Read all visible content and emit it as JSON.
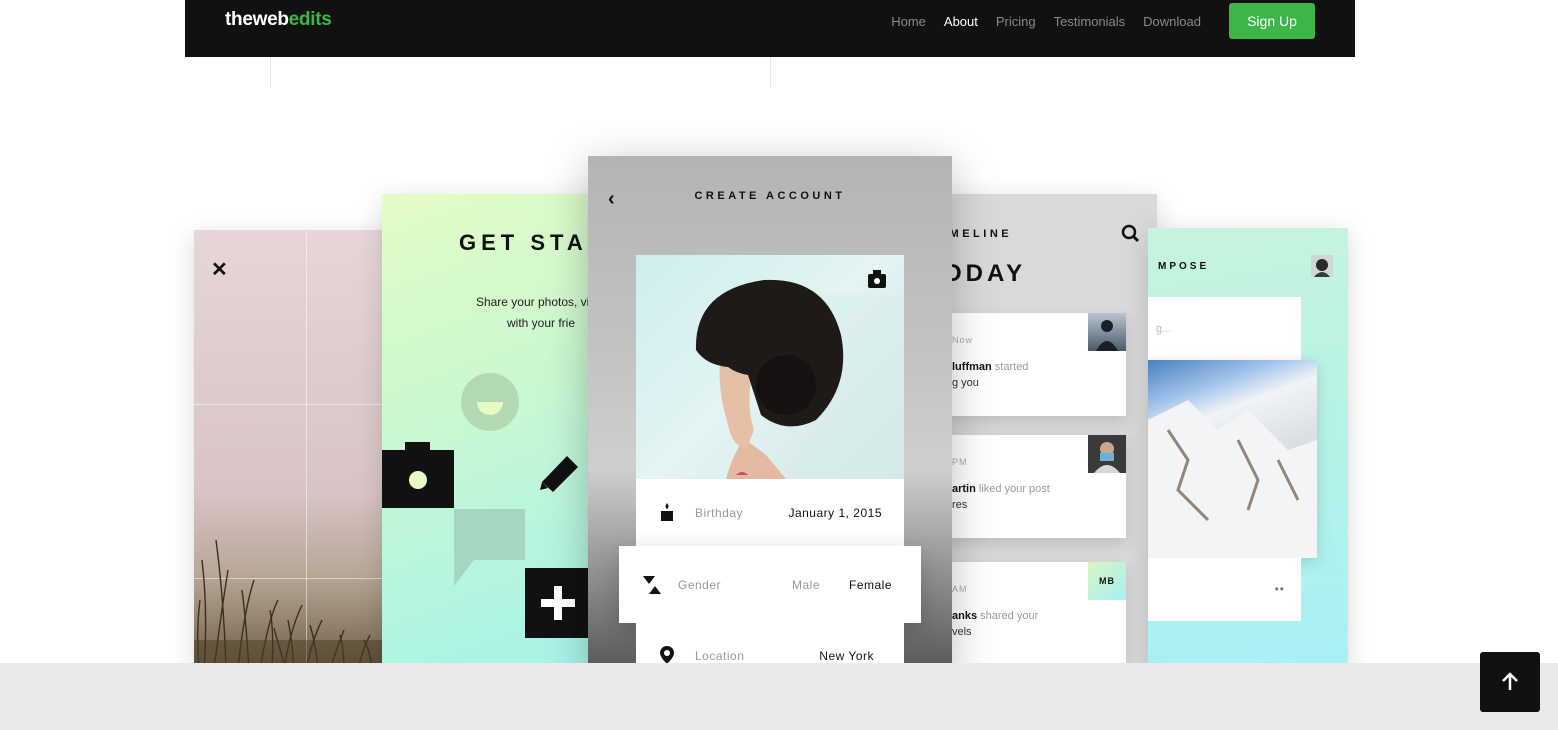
{
  "brand": {
    "part1": "theweb",
    "part2": "edits"
  },
  "nav": {
    "items": [
      "Home",
      "About",
      "Pricing",
      "Testimonials",
      "Download"
    ],
    "active": "About",
    "signup_label": "Sign Up"
  },
  "screens": {
    "get_started": {
      "title": "GET STA",
      "line1": "Share your photos, vid",
      "line2": "with your frie"
    },
    "create_account": {
      "title": "CREATE ACCOUNT",
      "fields": [
        {
          "label": "Birthday",
          "value": "January 1, 2015"
        },
        {
          "label": "Gender",
          "option_male": "Male",
          "option_female": "Female"
        },
        {
          "label": "Location",
          "value": "New York"
        }
      ]
    },
    "timeline": {
      "title": "IMELINE",
      "heading": "ODAY",
      "cards": [
        {
          "time": "Now",
          "name": "luffman",
          "action": "started",
          "line2": "g you"
        },
        {
          "time": "PM",
          "name": "artin",
          "action": "liked your post",
          "line2": "res"
        },
        {
          "time": "AM",
          "name": "anks",
          "action": "shared your",
          "line2": "vels",
          "badge": "MB"
        }
      ]
    },
    "compose": {
      "title": "MPOSE",
      "placeholder": "g...",
      "more": "••"
    }
  },
  "colors": {
    "brand_green": "#3cb54a",
    "nav_bg": "#111111",
    "footer_bg": "#eaeaea"
  }
}
